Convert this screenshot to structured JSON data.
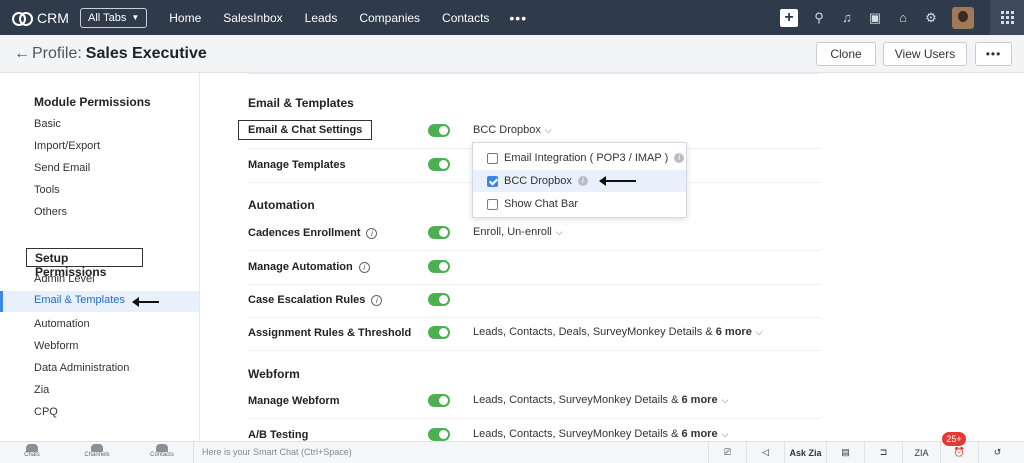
{
  "app": {
    "name": "CRM"
  },
  "nav": {
    "all_tabs": "All Tabs",
    "links": [
      "Home",
      "SalesInbox",
      "Leads",
      "Companies",
      "Contacts"
    ],
    "more": "•••"
  },
  "header": {
    "back": "←",
    "profile_label": "Profile:",
    "profile_name": "Sales Executive",
    "clone": "Clone",
    "view_users": "View Users",
    "more": "•••"
  },
  "sidebar": {
    "module_heading": "Module Permissions",
    "module_items": [
      "Basic",
      "Import/Export",
      "Send Email",
      "Tools",
      "Others"
    ],
    "setup_heading": "Setup Permissions",
    "setup_items": [
      "Admin Level",
      "Email & Templates",
      "Automation",
      "Webform",
      "Data Administration",
      "Zia",
      "CPQ"
    ],
    "active_item": "Email & Templates"
  },
  "main": {
    "sections": [
      {
        "title": "Email & Templates"
      },
      {
        "title": "Automation"
      },
      {
        "title": "Webform"
      }
    ],
    "rows": [
      {
        "label": "Email & Chat Settings",
        "enabled": true,
        "value": "BCC Dropbox"
      },
      {
        "label": "Manage Templates",
        "enabled": true,
        "value": ""
      },
      {
        "label": "Cadences Enrollment",
        "enabled": true,
        "value": "Enroll, Un-enroll"
      },
      {
        "label": "Manage Automation",
        "enabled": true,
        "value": ""
      },
      {
        "label": "Case Escalation Rules",
        "enabled": true,
        "value": ""
      },
      {
        "label": "Assignment Rules & Threshold",
        "enabled": true,
        "value": "Leads, Contacts, Deals, SurveyMonkey Details &",
        "more": "6 more"
      },
      {
        "label": "Manage Webform",
        "enabled": true,
        "value": "Leads, Contacts, SurveyMonkey Details &",
        "more": "6 more"
      },
      {
        "label": "A/B Testing",
        "enabled": true,
        "value": "Leads, Contacts, SurveyMonkey Details &",
        "more": "6 more"
      }
    ],
    "dropdown": {
      "options": [
        {
          "label": "Email Integration ( POP3 / IMAP )",
          "checked": false
        },
        {
          "label": "BCC Dropbox",
          "checked": true
        },
        {
          "label": "Show Chat Bar",
          "checked": false
        }
      ]
    }
  },
  "bottombar": {
    "items": [
      "Chats",
      "Channels",
      "Contacts"
    ],
    "smart_chat_placeholder": "Here is your Smart Chat (Ctrl+Space)",
    "ask_zia": "Ask Zia",
    "zia": "ZIA",
    "badge": "25+"
  },
  "colors": {
    "toggle_on": "#4caf50",
    "active_blue": "#3b86e8",
    "topbar": "#2f3a4a"
  }
}
